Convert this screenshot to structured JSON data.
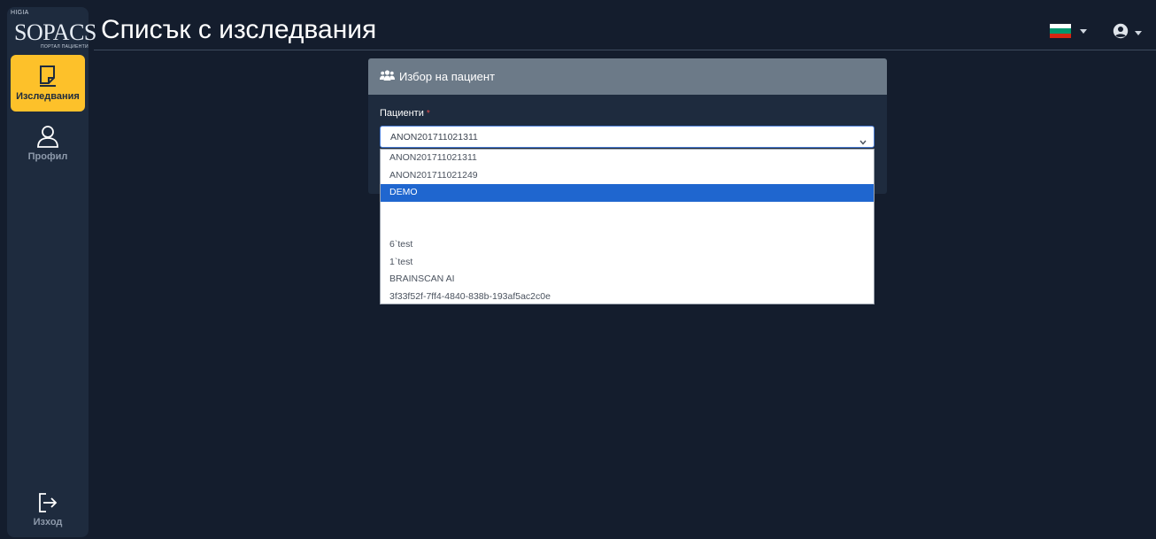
{
  "app": {
    "brand_small": "HIGIA",
    "brand_main": "SOPACS",
    "brand_sub": "ПОРТАЛ ПАЦИЕНТИ"
  },
  "header": {
    "title": "Списък с изследвания"
  },
  "sidebar": {
    "items": [
      {
        "label": "Изследвания",
        "icon": "document-icon",
        "active": true
      },
      {
        "label": "Профил",
        "icon": "user-icon",
        "active": false
      },
      {
        "label": "Изход",
        "icon": "logout-icon",
        "active": false
      }
    ]
  },
  "language": {
    "flag_colors": [
      "#ffffff",
      "#00966e",
      "#d62612"
    ]
  },
  "card": {
    "title": "Избор на пациент",
    "field_label": "Пациенти",
    "required_mark": "*",
    "selected_value": "ANON201711021311"
  },
  "dropdown": {
    "options": [
      "ANON201711021311",
      "ANON201711021249",
      "DEMO",
      "",
      "",
      "6`test",
      "1`test",
      "BRAINSCAN AI",
      "3f33f52f-7ff4-4840-838b-193af5ac2c0e"
    ],
    "highlighted_index": 2
  },
  "colors": {
    "background": "#141d2d",
    "sidebar": "#1e2b3e",
    "accent": "#fdc12a",
    "card_header": "#6c7a88",
    "option_highlight": "#1f66cf"
  }
}
